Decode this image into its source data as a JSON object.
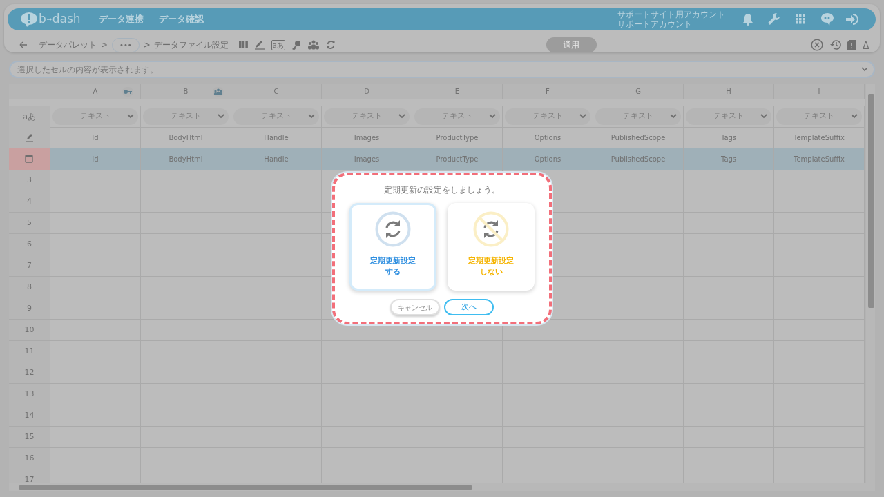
{
  "header": {
    "brand": {
      "left": "b",
      "right": "dash"
    },
    "nav": [
      "データ連携",
      "データ確認"
    ],
    "account": [
      "サポートサイト用アカウント",
      "サポートアカウント"
    ]
  },
  "toolbar": {
    "breadcrumb": {
      "first": "データパレット",
      "sep1": ">",
      "more": "•••",
      "sep2": ">",
      "current": "データファイル設定"
    },
    "text_type_icon": "aあ",
    "apply": {
      "label": "適用",
      "disabled": true
    },
    "font_button": "A"
  },
  "formula_bar": {
    "placeholder": "選択したセルの内容が表示されます。"
  },
  "grid": {
    "columns": [
      {
        "letter": "A",
        "kind": "key"
      },
      {
        "letter": "B",
        "kind": "group"
      },
      {
        "letter": "C"
      },
      {
        "letter": "D"
      },
      {
        "letter": "E"
      },
      {
        "letter": "F"
      },
      {
        "letter": "G"
      },
      {
        "letter": "H"
      },
      {
        "letter": "I"
      }
    ],
    "type_row_label": "aあ",
    "type_placeholders": [
      "テキスト",
      "テキスト",
      "テキスト",
      "テキスト",
      "テキスト",
      "テキスト",
      "テキスト",
      "テキスト",
      "テキスト"
    ],
    "rows": [
      {
        "kind": "name",
        "selected": false,
        "cells": [
          "Id",
          "BodyHtml",
          "Handle",
          "Images",
          "ProductType",
          "Options",
          "PublishedScope",
          "Tags",
          "TemplateSuffix"
        ]
      },
      {
        "kind": "header",
        "selected": true,
        "cells": [
          "Id",
          "BodyHtml",
          "Handle",
          "Images",
          "ProductType",
          "Options",
          "PublishedScope",
          "Tags",
          "TemplateSuffix"
        ]
      },
      {
        "kind": "data",
        "number": "3"
      },
      {
        "kind": "data",
        "number": "4"
      },
      {
        "kind": "data",
        "number": "5"
      },
      {
        "kind": "data",
        "number": "6"
      },
      {
        "kind": "data",
        "number": "7"
      },
      {
        "kind": "data",
        "number": "8"
      },
      {
        "kind": "data",
        "number": "9"
      },
      {
        "kind": "data",
        "number": "10"
      },
      {
        "kind": "data",
        "number": "11"
      },
      {
        "kind": "data",
        "number": "12"
      },
      {
        "kind": "data",
        "number": "13"
      },
      {
        "kind": "data",
        "number": "14"
      },
      {
        "kind": "data",
        "number": "15"
      },
      {
        "kind": "data",
        "number": "16"
      },
      {
        "kind": "data",
        "number": "17"
      }
    ]
  },
  "dialog": {
    "title": "定期更新の設定をしましょう。",
    "options": [
      {
        "kind": "enable",
        "selected": true,
        "lines": [
          "定期更新設定",
          "する"
        ]
      },
      {
        "kind": "disable",
        "selected": false,
        "lines": [
          "定期更新設定",
          "しない"
        ]
      }
    ],
    "cancel": "キャンセル",
    "next": "次へ"
  }
}
